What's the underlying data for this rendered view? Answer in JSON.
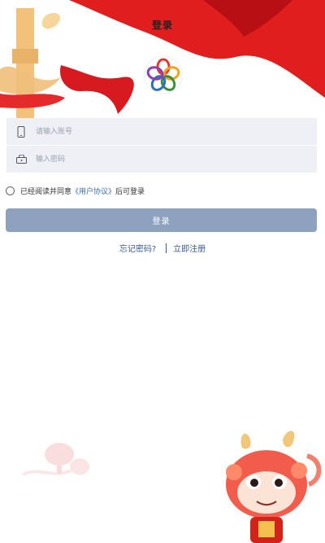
{
  "header": {
    "title": "登录"
  },
  "form": {
    "account_placeholder": "请输入账号",
    "password_placeholder": "输入密码"
  },
  "agreement": {
    "prefix": "已经阅读并同意",
    "link": "《用户协议》",
    "suffix": "后可登录"
  },
  "actions": {
    "login_label": "登录",
    "forgot_label": "忘记密码?",
    "register_label": "立即注册"
  },
  "colors": {
    "accent_red": "#e01e1e",
    "button_bg": "#8ea2bf",
    "link_blue": "#3c6cb5",
    "input_bg": "#eef0f5"
  },
  "icons": [
    "phone-icon",
    "lock-icon",
    "logo-icon",
    "flag-art",
    "dragon-art",
    "lantern-art"
  ]
}
